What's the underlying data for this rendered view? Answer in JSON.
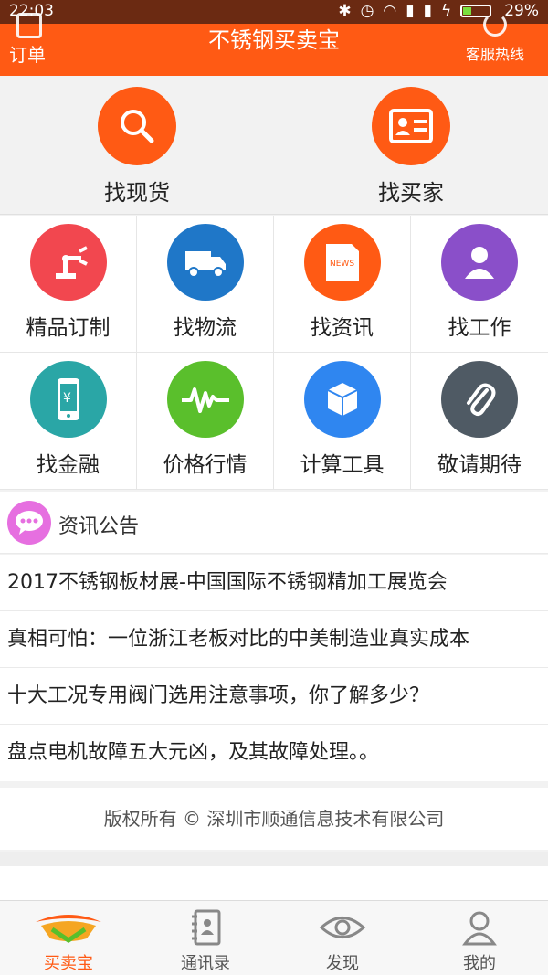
{
  "status_bar": {
    "time": "22:03",
    "battery": "29%"
  },
  "header": {
    "title": "不锈钢买卖宝",
    "left_label": "订单",
    "right_label": "客服热线"
  },
  "big_actions": [
    {
      "label": "找现货",
      "icon": "search-icon"
    },
    {
      "label": "找买家",
      "icon": "id-card-icon"
    }
  ],
  "grid": [
    {
      "label": "精品订制",
      "icon": "robot-arm-icon",
      "color": "#f2474f"
    },
    {
      "label": "找物流",
      "icon": "truck-icon",
      "color": "#1f77c8"
    },
    {
      "label": "找资讯",
      "icon": "news-icon",
      "color": "#ff5a14"
    },
    {
      "label": "找工作",
      "icon": "person-icon",
      "color": "#8a4fc9"
    },
    {
      "label": "找金融",
      "icon": "phone-yen-icon",
      "color": "#2aa6a6"
    },
    {
      "label": "价格行情",
      "icon": "pulse-icon",
      "color": "#5abf2c"
    },
    {
      "label": "计算工具",
      "icon": "box-icon",
      "color": "#2f86f0"
    },
    {
      "label": "敬请期待",
      "icon": "paperclip-icon",
      "color": "#4f5a64"
    }
  ],
  "news": {
    "title": "资讯公告",
    "items": [
      "2017不锈钢板材展-中国国际不锈钢精加工展览会",
      "真相可怕：一位浙江老板对比的中美制造业真实成本",
      "十大工况专用阀门选用注意事项，你了解多少？",
      "盘点电机故障五大元凶，及其故障处理。。"
    ]
  },
  "footer": {
    "copyright": "版权所有 © 深圳市顺通信息技术有限公司"
  },
  "tabs": [
    {
      "label": "买卖宝",
      "icon": "handshake-icon",
      "active": true
    },
    {
      "label": "通讯录",
      "icon": "contacts-icon",
      "active": false
    },
    {
      "label": "发现",
      "icon": "eye-icon",
      "active": false
    },
    {
      "label": "我的",
      "icon": "user-icon",
      "active": false
    }
  ],
  "colors": {
    "brand": "#ff5a14",
    "status_bar": "#6b2a12"
  }
}
